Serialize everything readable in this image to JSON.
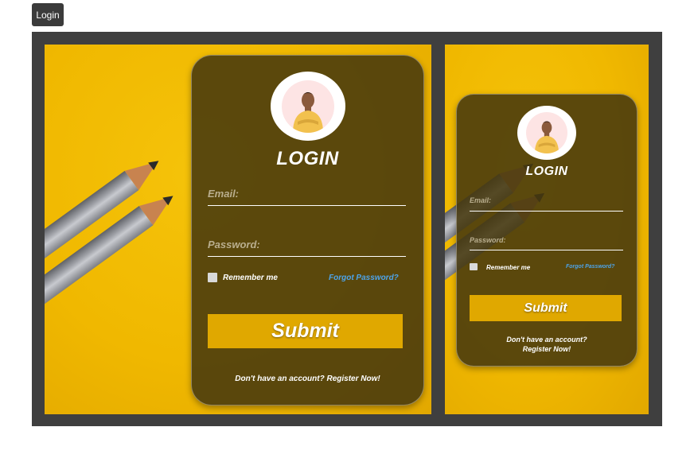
{
  "top_button": {
    "label": "Login"
  },
  "login_form": {
    "title": "LOGIN",
    "email_label": "Email:",
    "password_label": "Password:",
    "remember_label": "Remember me",
    "remember_checked": false,
    "forgot_link": "Forgot Password?",
    "submit_label": "Submit",
    "register_text": "Don't have an account? Register Now!",
    "register_line1": "Don't have an account?",
    "register_line2": "Register Now!"
  },
  "colors": {
    "background_yellow": "#f0b800",
    "card_overlay": "#46380e",
    "submit_bg": "#e0a800",
    "link_blue": "#4da3e8",
    "frame": "#3f3f3f"
  },
  "icons": [
    "avatar-icon",
    "pencil-icon"
  ]
}
